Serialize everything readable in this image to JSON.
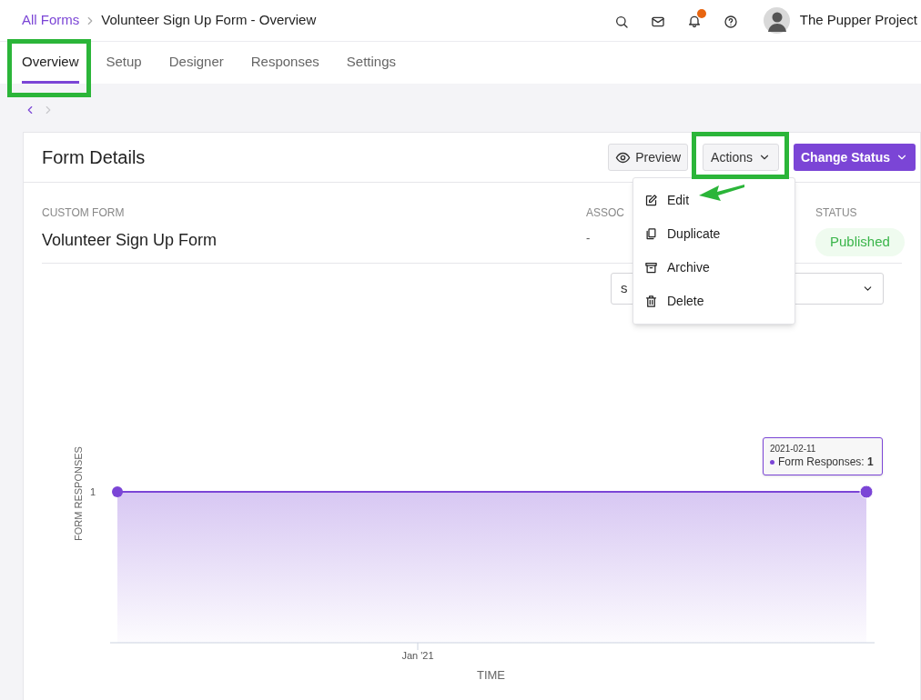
{
  "breadcrumb": {
    "link": "All Forms",
    "current": "Volunteer Sign Up Form - Overview"
  },
  "header": {
    "notifications_unread": true,
    "account_name": "The Pupper Project"
  },
  "tabs": [
    {
      "label": "Overview",
      "selected": true
    },
    {
      "label": "Setup",
      "selected": false
    },
    {
      "label": "Designer",
      "selected": false
    },
    {
      "label": "Responses",
      "selected": false
    },
    {
      "label": "Settings",
      "selected": false
    }
  ],
  "pager": {
    "prev_disabled": false,
    "next_disabled": true
  },
  "card": {
    "title": "Form Details",
    "buttons": [
      {
        "kind": "preview",
        "label": "Preview"
      },
      {
        "kind": "menu",
        "label": "Actions"
      },
      {
        "kind": "primary",
        "label": "Change Status"
      }
    ]
  },
  "details": [
    {
      "kind": "text",
      "label": "CUSTOM FORM",
      "value": "Volunteer Sign Up Form"
    },
    {
      "kind": "muted",
      "label": "ASSOC",
      "value": "-"
    },
    {
      "kind": "badge",
      "label": "STATUS",
      "value": "Published"
    }
  ],
  "filter_select": {
    "value": "s"
  },
  "actions_menu": {
    "items": [
      {
        "kind": "edit",
        "label": "Edit"
      },
      {
        "kind": "duplicate",
        "label": "Duplicate"
      },
      {
        "kind": "archive",
        "label": "Archive"
      },
      {
        "kind": "delete",
        "label": "Delete"
      }
    ]
  },
  "chart": {
    "xlabel": "TIME",
    "ylabel": "FORM RESPONSES",
    "y_tick": "1",
    "x_tick": "Jan '21"
  },
  "tooltip": {
    "date": "2021-02-11",
    "text": "Form Responses: **1**"
  },
  "annotations": [
    {
      "kind": "box"
    },
    {
      "kind": "box"
    },
    {
      "kind": "arrow"
    }
  ]
}
